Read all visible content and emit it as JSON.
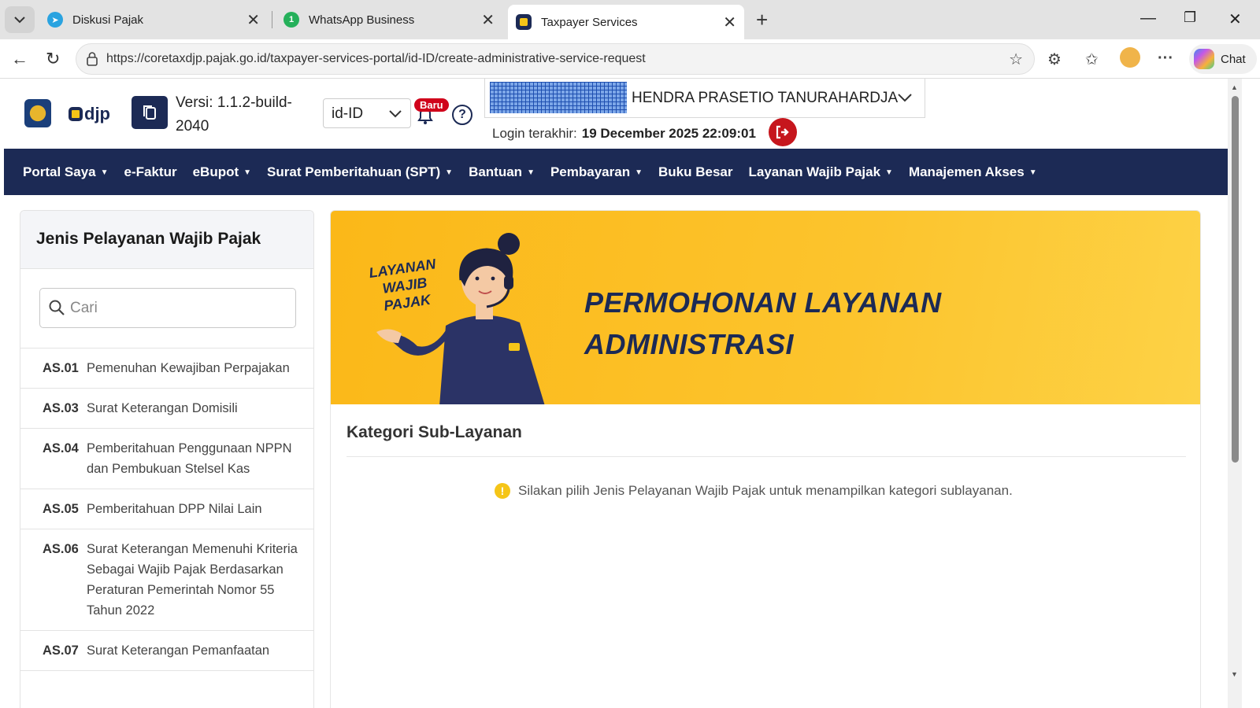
{
  "browser": {
    "tabs": [
      {
        "title": "Diskusi Pajak",
        "icon": "telegram-icon"
      },
      {
        "title": "WhatsApp Business",
        "icon": "whatsapp-icon",
        "badge": "1"
      },
      {
        "title": "Taxpayer Services",
        "icon": "djp-icon",
        "active": true
      }
    ],
    "url": "https://coretaxdjp.pajak.go.id/taxpayer-services-portal/id-ID/create-administrative-service-request",
    "chat_label": "Chat"
  },
  "header": {
    "brand": "djp",
    "version_label": "Versi:",
    "version_value": "1.1.2-build-2040",
    "language": "id-ID",
    "new_badge": "Baru",
    "user_name": "HENDRA PRASETIO TANURAHARDJA",
    "last_login_label": "Login terakhir:",
    "last_login_value": "19 December 2025 22:09:01"
  },
  "nav": {
    "items": [
      {
        "label": "Portal Saya",
        "dropdown": true
      },
      {
        "label": "e-Faktur",
        "dropdown": false
      },
      {
        "label": "eBupot",
        "dropdown": true
      },
      {
        "label": "Surat Pemberitahuan (SPT)",
        "dropdown": true
      },
      {
        "label": "Bantuan",
        "dropdown": true
      },
      {
        "label": "Pembayaran",
        "dropdown": true
      },
      {
        "label": "Buku Besar",
        "dropdown": false
      },
      {
        "label": "Layanan Wajib Pajak",
        "dropdown": true
      },
      {
        "label": "Manajemen Akses",
        "dropdown": true
      }
    ]
  },
  "sidebar": {
    "title": "Jenis Pelayanan Wajib Pajak",
    "search_placeholder": "Cari",
    "services": [
      {
        "code": "AS.01",
        "name": "Pemenuhan Kewajiban Perpajakan"
      },
      {
        "code": "AS.03",
        "name": "Surat Keterangan Domisili"
      },
      {
        "code": "AS.04",
        "name": "Pemberitahuan Penggunaan NPPN dan Pembukuan Stelsel Kas"
      },
      {
        "code": "AS.05",
        "name": "Pemberitahuan DPP Nilai Lain"
      },
      {
        "code": "AS.06",
        "name": "Surat Keterangan Memenuhi Kriteria Sebagai Wajib Pajak Berdasarkan Peraturan Pemerintah Nomor 55 Tahun 2022"
      },
      {
        "code": "AS.07",
        "name": "Surat Keterangan Pemanfaatan"
      }
    ]
  },
  "main": {
    "banner_stamp": "LAYANAN WAJIB PAJAK",
    "banner_title_line1": "PERMOHONAN LAYANAN",
    "banner_title_line2": "ADMINISTRASI",
    "sub_title": "Kategori Sub-Layanan",
    "info_message": "Silakan pilih Jenis Pelayanan Wajib Pajak untuk menampilkan kategori sublayanan."
  },
  "colors": {
    "primary_navy": "#1c2a55",
    "banner_yellow": "#fbb818",
    "logout_red": "#c6161d",
    "badge_red": "#d0021b"
  }
}
